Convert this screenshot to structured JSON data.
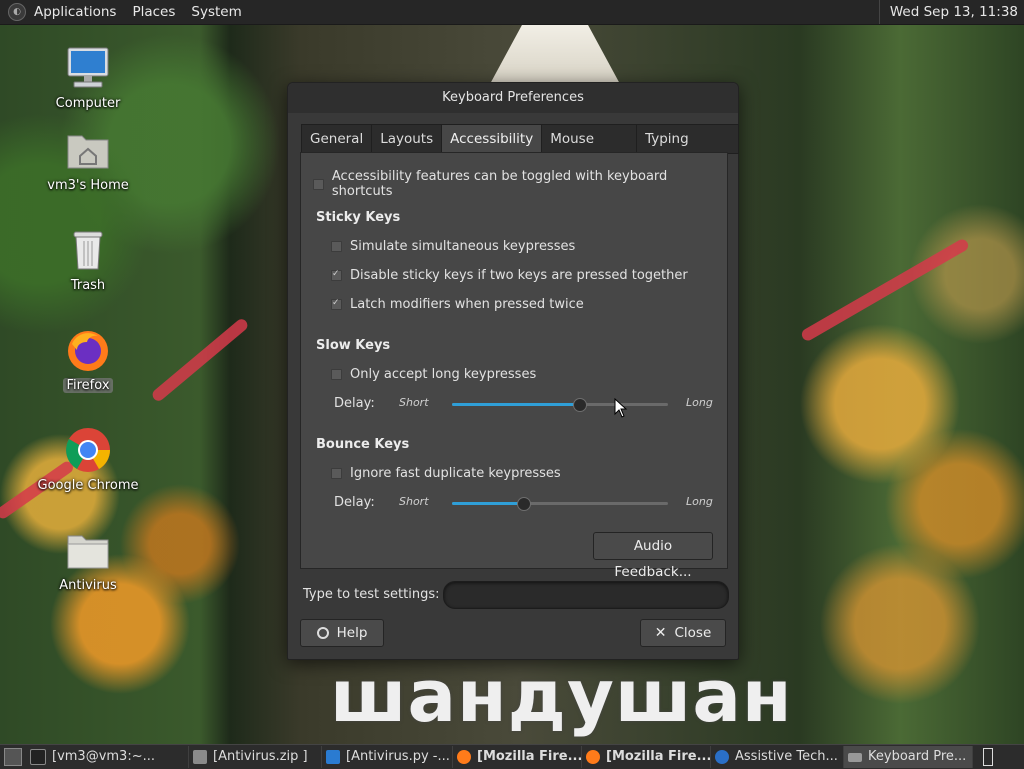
{
  "top_panel": {
    "menus": [
      "Applications",
      "Places",
      "System"
    ],
    "clock": "Wed Sep 13, 11:38"
  },
  "desktop": {
    "icons": [
      {
        "label": "Computer",
        "icon": "computer-icon"
      },
      {
        "label": "vm3's Home",
        "icon": "home-folder-icon"
      },
      {
        "label": "Trash",
        "icon": "trash-icon"
      },
      {
        "label": "Firefox",
        "icon": "firefox-icon",
        "selected": true
      },
      {
        "label": "Google Chrome",
        "icon": "chrome-icon"
      },
      {
        "label": "Antivirus",
        "icon": "folder-icon"
      }
    ],
    "wallpaper_text": "шандушан"
  },
  "dialog": {
    "title": "Keyboard Preferences",
    "tabs": [
      "General",
      "Layouts",
      "Accessibility",
      "Mouse Keys",
      "Typing Break"
    ],
    "active_tab": "Accessibility",
    "toggle_option": {
      "label": "Accessibility features can be toggled with keyboard shortcuts",
      "checked": false
    },
    "sticky": {
      "heading": "Sticky Keys",
      "options": [
        {
          "label": "Simulate simultaneous keypresses",
          "checked": false
        },
        {
          "label": "Disable sticky keys if two keys are pressed together",
          "checked": true
        },
        {
          "label": "Latch modifiers when pressed twice",
          "checked": true
        }
      ]
    },
    "slow": {
      "heading": "Slow Keys",
      "option": {
        "label": "Only accept long keypresses",
        "checked": false
      },
      "delay_label": "Delay:",
      "min_label": "Short",
      "max_label": "Long",
      "value": 0.59
    },
    "bounce": {
      "heading": "Bounce Keys",
      "option": {
        "label": "Ignore fast duplicate keypresses",
        "checked": false
      },
      "delay_label": "Delay:",
      "min_label": "Short",
      "max_label": "Long",
      "value": 0.33
    },
    "audio_feedback_button": "Audio Feedback...",
    "test_label": "Type to test settings:",
    "test_value": "",
    "help_button": "Help",
    "close_button": "Close"
  },
  "taskbar": {
    "tasks": [
      {
        "label": "[vm3@vm3:~...",
        "icon": "terminal-icon",
        "bold": false
      },
      {
        "label": "[Antivirus.zip ]",
        "icon": "archive-icon",
        "bold": false
      },
      {
        "label": "[Antivirus.py -...",
        "icon": "vscode-icon",
        "bold": false
      },
      {
        "label": "[Mozilla Fire...",
        "icon": "firefox-icon",
        "bold": true
      },
      {
        "label": "[Mozilla Fire...",
        "icon": "firefox-icon",
        "bold": true
      },
      {
        "label": "Assistive Tech...",
        "icon": "accessibility-icon",
        "bold": false
      },
      {
        "label": "Keyboard Pre...",
        "icon": "keyboard-icon",
        "bold": false,
        "active": true
      }
    ]
  },
  "colors": {
    "accent": "#2f9fd8",
    "panel": "#262626",
    "dialog": "#393939"
  }
}
